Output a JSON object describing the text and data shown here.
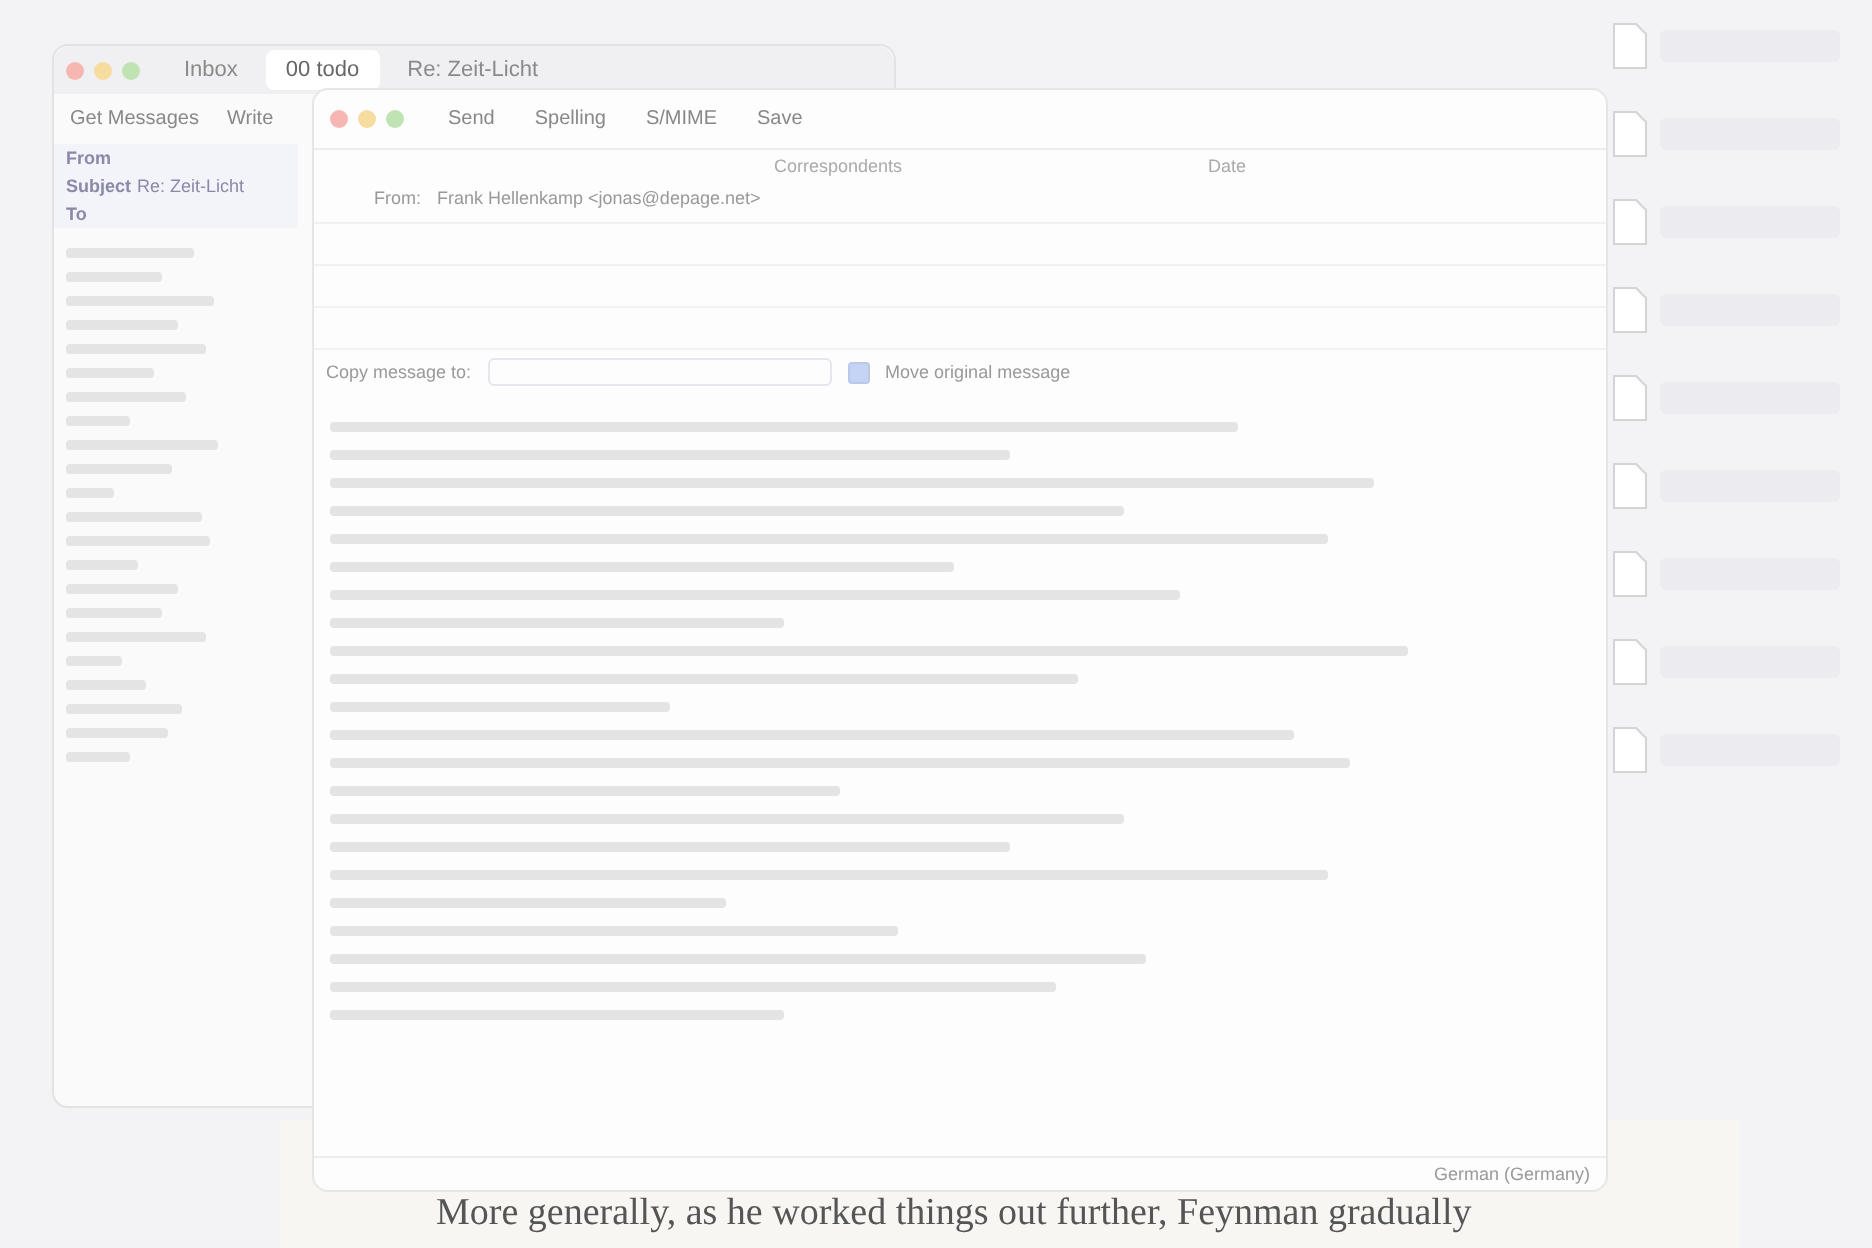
{
  "main_window": {
    "tabs": [
      {
        "label": "Inbox",
        "selected": false
      },
      {
        "label": "00 todo",
        "selected": true
      },
      {
        "label": "Re: Zeit-Licht",
        "selected": false
      }
    ],
    "toolbar": [
      "Get Messages",
      "Write"
    ],
    "header": [
      {
        "label": "From"
      },
      {
        "label": "Subject",
        "value": "Re: Zeit-Licht"
      },
      {
        "label": "To"
      }
    ]
  },
  "compose_window": {
    "toolbar": [
      "Send",
      "Spelling",
      "S/MIME",
      "Save"
    ],
    "columns": [
      "Correspondents",
      "Date"
    ],
    "fields": [
      {
        "label": "From:",
        "value": "Frank Hellenkamp <jonas@depage.net>"
      }
    ],
    "copy_label": "Copy message to:",
    "move_original": {
      "label": "Move original message",
      "checked": true
    },
    "language": "German (Germany)"
  },
  "book_text": "More generally, as he worked things out further, Feynman gradually"
}
